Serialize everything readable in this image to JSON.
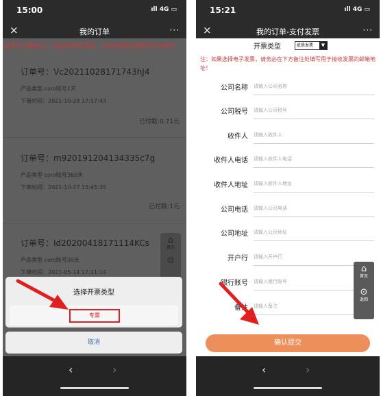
{
  "left": {
    "status": {
      "time": "15:00",
      "signal": "ıll 4G ▭"
    },
    "title": "我的订单",
    "close_icon": "×",
    "more_icon": "···",
    "notice": "请填写正确信息，如信息填写错误，开具失败的发票将无法重开",
    "orders": [
      {
        "no": "订单号：Vc20211028171743hJ4",
        "type": "产品类型  coro账号1天",
        "time": "下单时间：2021-10-28 17:17:43",
        "paid": "已付款:0.71元"
      },
      {
        "no": "订单号：m920191204134335c7g",
        "type": "产品类型  coro账号360天",
        "time": "下单时间：2021-10-27 15:45:35",
        "paid": "已付款:1元"
      },
      {
        "no": "订单号：Id20200418171114KCs",
        "type": "产品类型  coro账号30天",
        "time": "下单时间：2021-05-14 17:11:14",
        "paid": ""
      }
    ],
    "side": {
      "home_label": "首页",
      "back_label": "返回"
    },
    "sheet": {
      "title": "选择开票类型",
      "option": "专票",
      "cancel": "取消"
    }
  },
  "right": {
    "status": {
      "time": "15:21",
      "signal": "ıll 4G ▭"
    },
    "title": "我的订单-支付发票",
    "close_icon": "×",
    "more_icon": "···",
    "invoice_type_label": "开票类型",
    "invoice_type_value": "纸质发票",
    "note": "注：如果选择电子发票，请务必在下方备注处填写用于接收发票的邮箱地址！",
    "fields": [
      {
        "label": "公司名称",
        "placeholder": "请输入公司名称"
      },
      {
        "label": "公司税号",
        "placeholder": "请输入公司税号"
      },
      {
        "label": "收件人",
        "placeholder": "请输入收件人"
      },
      {
        "label": "收件人电话",
        "placeholder": "请输入收件人电话"
      },
      {
        "label": "收件人地址",
        "placeholder": "请输入收件人地址"
      },
      {
        "label": "公司电话",
        "placeholder": "请输入公司电话"
      },
      {
        "label": "公司地址",
        "placeholder": "请输入公司地址"
      },
      {
        "label": "开户行",
        "placeholder": "请输入开户行"
      },
      {
        "label": "银行账号",
        "placeholder": "请输入银行账号"
      },
      {
        "label": "备注",
        "placeholder": "请输入备注"
      }
    ],
    "submit": "确认提交",
    "side": {
      "home_label": "首页",
      "back_label": "返回"
    }
  },
  "nav": {
    "back": "‹",
    "forward": "›"
  },
  "colors": {
    "arrow": "#e02020",
    "submit": "#ec8f5a",
    "notice": "#c93b3b"
  }
}
